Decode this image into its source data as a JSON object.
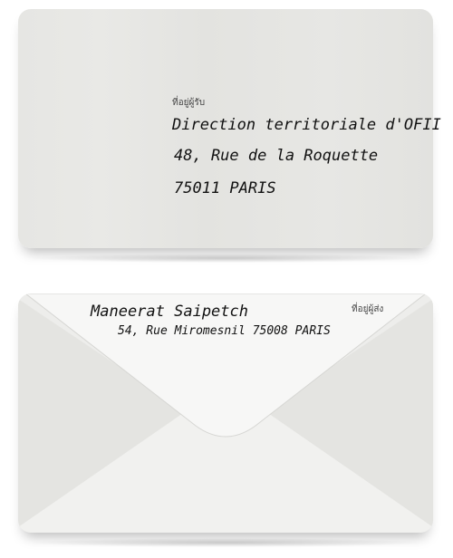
{
  "front": {
    "recipient_label": "ที่อยู่ผู้รับ",
    "recipient_line1": "Direction territoriale d'OFII",
    "recipient_line2": "48, Rue de la Roquette",
    "recipient_line3": "75011  PARIS"
  },
  "back": {
    "sender_label": "ที่อยู่ผู้ส่ง",
    "sender_line1": "Maneerat  Saipetch",
    "sender_line2": "54, Rue Miromesnil 75008 PARIS"
  },
  "colors": {
    "envelope": "#ededeb",
    "flap": "#f7f7f6",
    "text": "#111111"
  }
}
